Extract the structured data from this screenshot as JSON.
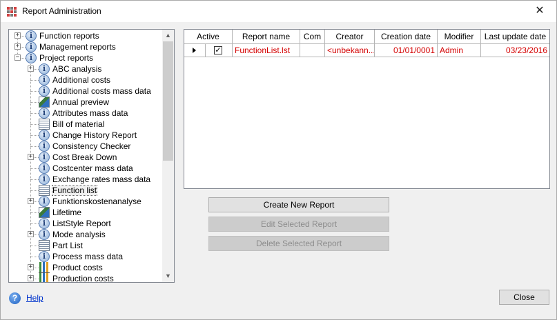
{
  "window": {
    "title": "Report Administration",
    "close_glyph": "✕"
  },
  "tree": {
    "items": [
      {
        "label": "Function reports",
        "level": 0,
        "icon": "info-icon",
        "expander": "+"
      },
      {
        "label": "Management reports",
        "level": 0,
        "icon": "info-icon",
        "expander": "+"
      },
      {
        "label": "Project reports",
        "level": 0,
        "icon": "info-icon",
        "expander": "−"
      },
      {
        "label": "ABC analysis",
        "level": 1,
        "icon": "info-icon",
        "expander": "+"
      },
      {
        "label": "Additional costs",
        "level": 1,
        "icon": "info-icon",
        "expander": ""
      },
      {
        "label": "Additional costs mass data",
        "level": 1,
        "icon": "info-icon",
        "expander": ""
      },
      {
        "label": "Annual preview",
        "level": 1,
        "icon": "picture-icon",
        "expander": ""
      },
      {
        "label": "Attributes mass data",
        "level": 1,
        "icon": "info-icon",
        "expander": ""
      },
      {
        "label": "Bill of material",
        "level": 1,
        "icon": "list-icon",
        "expander": ""
      },
      {
        "label": "Change History Report",
        "level": 1,
        "icon": "info-icon",
        "expander": ""
      },
      {
        "label": "Consistency Checker",
        "level": 1,
        "icon": "info-icon",
        "expander": ""
      },
      {
        "label": "Cost Break Down",
        "level": 1,
        "icon": "info-icon",
        "expander": "+"
      },
      {
        "label": "Costcenter mass data",
        "level": 1,
        "icon": "info-icon",
        "expander": ""
      },
      {
        "label": "Exchange rates mass data",
        "level": 1,
        "icon": "info-icon",
        "expander": ""
      },
      {
        "label": "Function list",
        "level": 1,
        "icon": "list-icon",
        "expander": "",
        "selected": true
      },
      {
        "label": "Funktionskostenanalyse",
        "level": 1,
        "icon": "info-icon",
        "expander": "+"
      },
      {
        "label": "Lifetime",
        "level": 1,
        "icon": "picture-icon",
        "expander": ""
      },
      {
        "label": "ListStyle Report",
        "level": 1,
        "icon": "info-icon",
        "expander": ""
      },
      {
        "label": "Mode analysis",
        "level": 1,
        "icon": "info-icon",
        "expander": "+"
      },
      {
        "label": "Part List",
        "level": 1,
        "icon": "list-icon",
        "expander": ""
      },
      {
        "label": "Process mass data",
        "level": 1,
        "icon": "info-icon",
        "expander": ""
      },
      {
        "label": "Product costs",
        "level": 1,
        "icon": "bar-chart-icon",
        "expander": "+"
      },
      {
        "label": "Production costs",
        "level": 1,
        "icon": "bar-chart-icon",
        "expander": "+"
      }
    ]
  },
  "grid": {
    "columns": [
      "Active",
      "Report name",
      "Com",
      "Creator",
      "Creation date",
      "Modifier",
      "Last update date"
    ],
    "rows": [
      {
        "active_mark": "✓",
        "report_name": "FunctionList.lst",
        "com": "",
        "creator": "<unbekann...",
        "creation_date": "01/01/0001",
        "modifier": "Admin",
        "last_update_date": "03/23/2016"
      }
    ],
    "value_color": "#d40000"
  },
  "buttons": {
    "create": "Create New Report",
    "edit": "Edit Selected Report",
    "delete": "Delete Selected Report",
    "close": "Close"
  },
  "help": {
    "label": "Help",
    "icon_glyph": "?"
  }
}
